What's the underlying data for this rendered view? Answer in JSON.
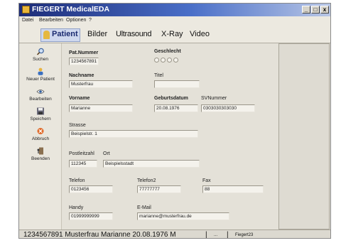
{
  "window": {
    "title": "FIEGERT MedicalEDA"
  },
  "window_buttons": {
    "minimize": "_",
    "maximize": "□",
    "close": "x"
  },
  "menu": [
    "Datei",
    "Bearbeiten",
    "Optionen",
    "?"
  ],
  "tabs": [
    "Patient",
    "Bilder",
    "Ultrasound",
    "X-Ray",
    "Video"
  ],
  "sidebar": [
    {
      "label": "Suchen",
      "icon": "magnifier-icon"
    },
    {
      "label": "Neuer Patient",
      "icon": "new-patient-icon"
    },
    {
      "label": "Bearbeiten",
      "icon": "edit-icon"
    },
    {
      "label": "Speichern",
      "icon": "save-disk-icon"
    },
    {
      "label": "Abbruch",
      "icon": "cancel-icon"
    },
    {
      "label": "Beenden",
      "icon": "exit-icon"
    }
  ],
  "form": {
    "pat_nummer": {
      "label": "Pat.Nummer",
      "value": "1234567891"
    },
    "geschlecht": {
      "label": "Geschlecht"
    },
    "nachname": {
      "label": "Nachname",
      "value": "Musterfrau"
    },
    "titel": {
      "label": "Titel",
      "value": ""
    },
    "vorname": {
      "label": "Vorname",
      "value": "Marianne"
    },
    "geburtsdatum": {
      "label": "Geburtsdatum",
      "value": "20.08.1976"
    },
    "sv_nummer": {
      "label": "SVNummer",
      "value": "0303030303030"
    },
    "strasse": {
      "label": "Strasse",
      "value": "Beispielstr. 1"
    },
    "postleitzahl": {
      "label": "Postleitzahl",
      "value": "112345"
    },
    "ort": {
      "label": "Ort",
      "value": "Beispielsstadt"
    },
    "telefon": {
      "label": "Telefon",
      "value": "0123456"
    },
    "telefon2": {
      "label": "Telefon2",
      "value": "77777777"
    },
    "fax": {
      "label": "Fax",
      "value": "88"
    },
    "handy": {
      "label": "Handy",
      "value": "01999999999"
    },
    "email": {
      "label": "E-Mail",
      "value": "marianne@musterfrau.de"
    }
  },
  "statusbar": {
    "main": "1234567891 Musterfrau Marianne 20.08.1976 M",
    "sep1": "|",
    "mid": "...",
    "sep2": "|",
    "user": "Fiegert23"
  }
}
